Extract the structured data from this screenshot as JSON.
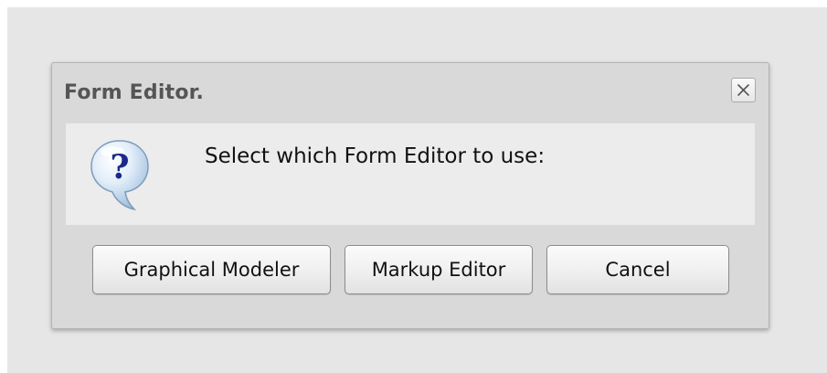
{
  "dialog": {
    "title": "Form Editor.",
    "message": "Select which Form Editor to use:",
    "icon": "question-bubble-icon",
    "close_icon": "close-icon"
  },
  "buttons": {
    "graphical_modeler": "Graphical Modeler",
    "markup_editor": "Markup Editor",
    "cancel": "Cancel"
  }
}
